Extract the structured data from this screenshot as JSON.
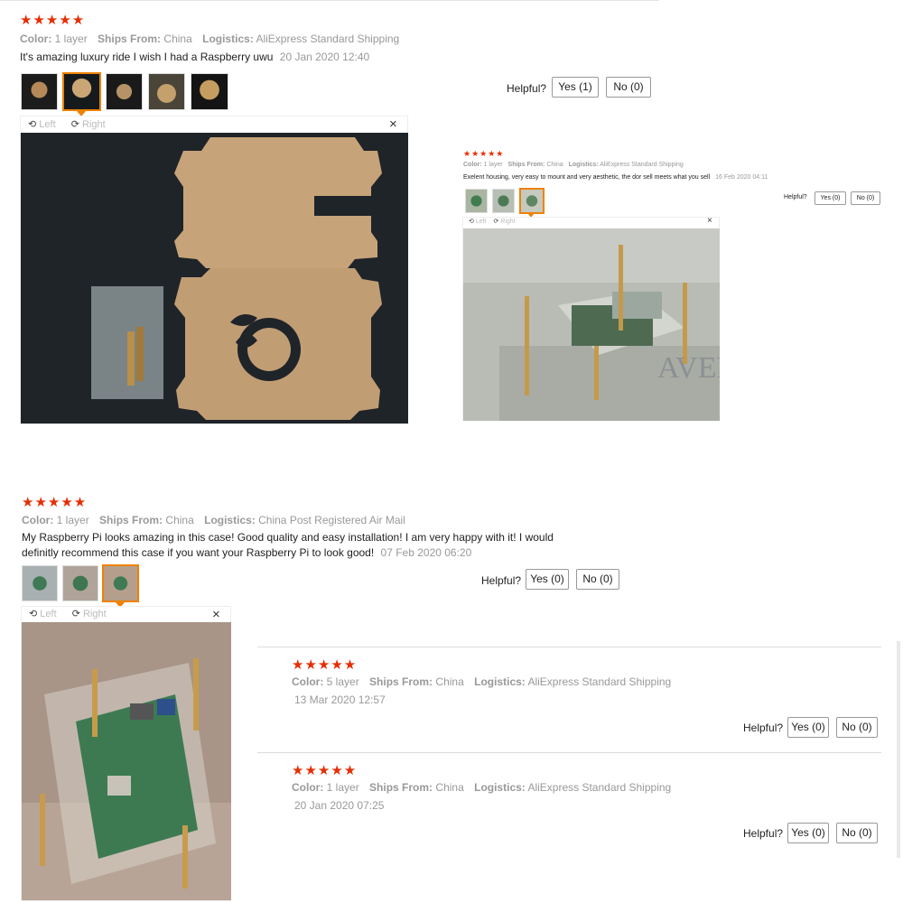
{
  "review1": {
    "stars": "★★★★★",
    "color_label": "Color:",
    "color_value": "1 layer",
    "ships_label": "Ships From:",
    "ships_value": "China",
    "logistics_label": "Logistics:",
    "logistics_value": "AliExpress Standard Shipping",
    "text": "It's amazing luxury ride I wish I had a Raspberry uwu",
    "date": "20 Jan 2020 12:40",
    "helpful": "Helpful?",
    "yes": "Yes (1)",
    "no": "No (0)",
    "viewer": {
      "left": "Left",
      "right": "Right",
      "close": "×"
    }
  },
  "review2": {
    "stars": "★★★★★",
    "color_label": "Color:",
    "color_value": "1 layer",
    "ships_label": "Ships From:",
    "ships_value": "China",
    "logistics_label": "Logistics:",
    "logistics_value": "AliExpress Standard Shipping",
    "text": "Exelent housing, very easy to mount and very aesthetic, the dor sell meets what you sell",
    "date": "16 Feb 2020 04:11",
    "helpful": "Helpful?",
    "yes": "Yes (0)",
    "no": "No (0)",
    "viewer": {
      "left": "Left",
      "right": "Right",
      "close": "×"
    }
  },
  "review3": {
    "stars": "★★★★★",
    "color_label": "Color:",
    "color_value": "1 layer",
    "ships_label": "Ships From:",
    "ships_value": "China",
    "logistics_label": "Logistics:",
    "logistics_value": "China Post Registered Air Mail",
    "text": "My Raspberry Pi looks amazing in this case! Good quality and easy installation! I am very happy with it! I would definitly recommend this case if you want your Raspberry Pi to look good!",
    "date": "07 Feb 2020 06:20",
    "helpful": "Helpful?",
    "yes": "Yes (0)",
    "no": "No (0)",
    "viewer": {
      "left": "Left",
      "right": "Right",
      "close": "×"
    }
  },
  "review4": {
    "stars": "★★★★★",
    "color_label": "Color:",
    "color_value": "5 layer",
    "ships_label": "Ships From:",
    "ships_value": "China",
    "logistics_label": "Logistics:",
    "logistics_value": "AliExpress Standard Shipping",
    "date": "13 Mar 2020 12:57",
    "helpful": "Helpful?",
    "yes": "Yes (0)",
    "no": "No (0)"
  },
  "review5": {
    "stars": "★★★★★",
    "color_label": "Color:",
    "color_value": "1 layer",
    "ships_label": "Ships From:",
    "ships_value": "China",
    "logistics_label": "Logistics:",
    "logistics_value": "AliExpress Standard Shipping",
    "date": "20 Jan 2020 07:25",
    "helpful": "Helpful?",
    "yes": "Yes (0)",
    "no": "No (0)"
  },
  "colors": {
    "star": "#e62e04",
    "selected_thumb": "#f08200",
    "meta_text": "#999999"
  },
  "icons": {
    "rotate_left": "rotate-left-icon",
    "rotate_right": "rotate-right-icon",
    "close": "close-icon"
  }
}
